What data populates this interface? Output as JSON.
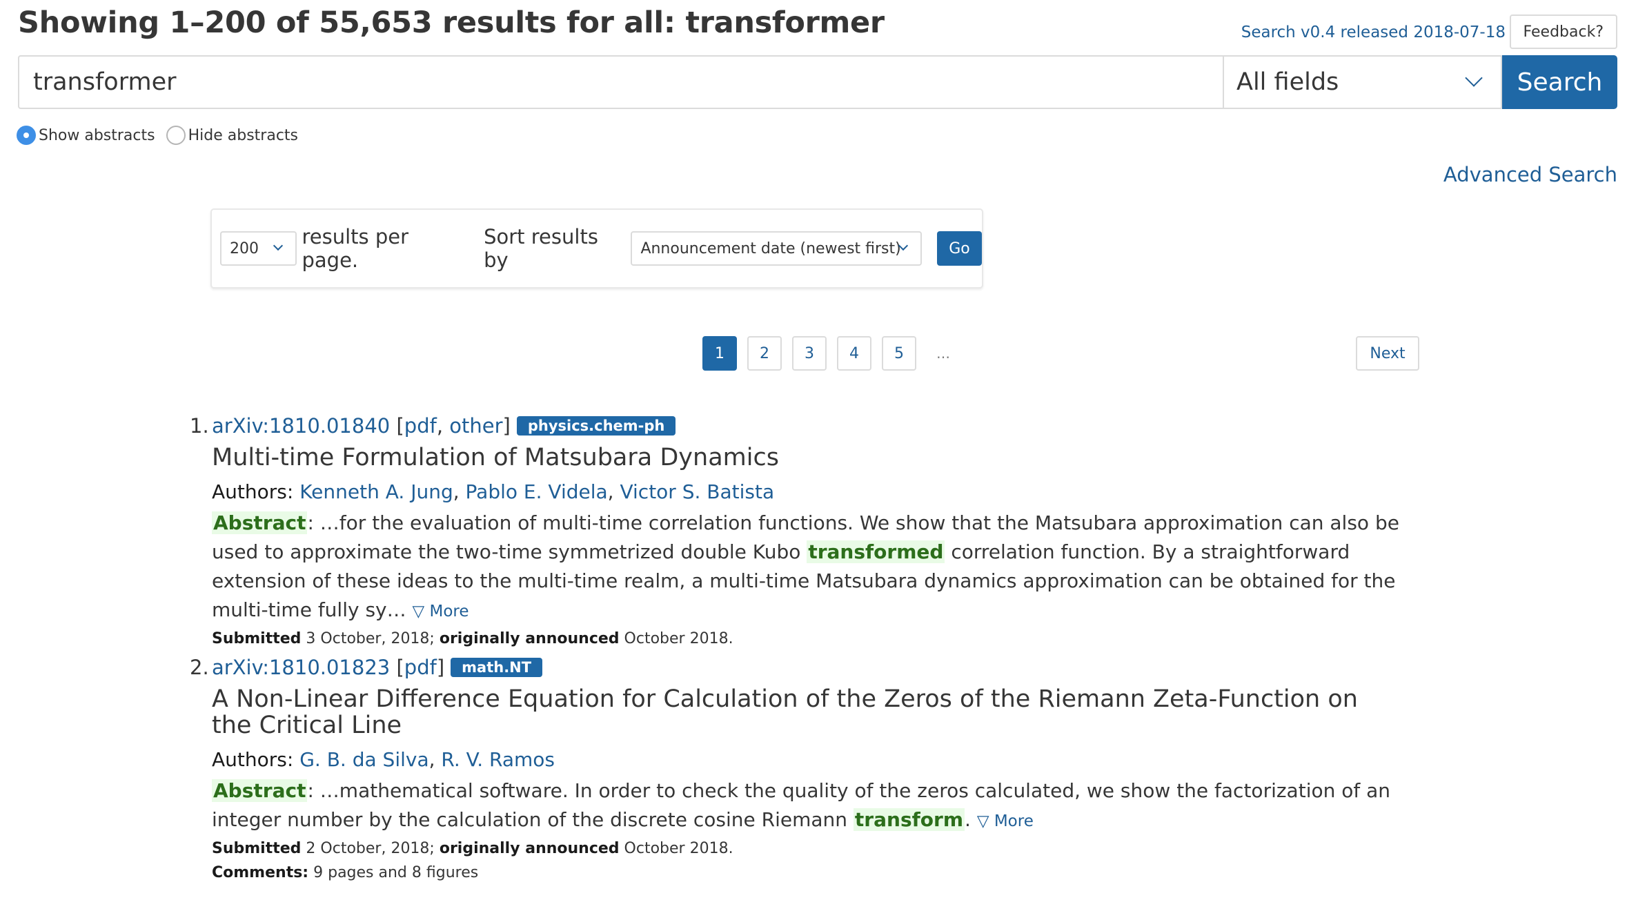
{
  "header": {
    "title": "Showing 1–200 of 55,653 results for all: transformer",
    "release_link": "Search v0.4 released 2018-07-18",
    "feedback_label": "Feedback?"
  },
  "search": {
    "query": "transformer",
    "field": "All fields",
    "button_label": "Search"
  },
  "abstract_toggle": {
    "show_label": "Show abstracts",
    "hide_label": "Hide abstracts",
    "selected": "show"
  },
  "advanced_search_label": "Advanced Search",
  "controls": {
    "per_page": "200",
    "per_page_label": "results per page.",
    "sort_label": "Sort results by",
    "sort_value": "Announcement date (newest first)",
    "go_label": "Go"
  },
  "pagination": {
    "pages": [
      "1",
      "2",
      "3",
      "4",
      "5"
    ],
    "current": "1",
    "ellipsis": "…",
    "next_label": "Next"
  },
  "colors": {
    "accent": "#1f68a6",
    "link": "#1f5e96",
    "highlight_bg": "#e9fbe6",
    "highlight_text": "#2c6e1b"
  },
  "results": [
    {
      "num": "1.",
      "arxiv_id": "arXiv:1810.01840",
      "links": [
        "pdf",
        "other"
      ],
      "category": "physics.chem-ph",
      "title": "Multi-time Formulation of Matsubara Dynamics",
      "authors_label": "Authors:",
      "authors": [
        "Kenneth A. Jung",
        "Pablo E. Videla",
        "Victor S. Batista"
      ],
      "abstract_label": "Abstract",
      "abstract_pre": ": …for the evaluation of multi-time correlation functions. We show that the Matsubara approximation can also be used to approximate the two-time symmetrized double Kubo ",
      "abstract_hl": "transformed",
      "abstract_post": " correlation function. By a straightforward extension of these ideas to the multi-time realm, a multi-time Matsubara dynamics approximation can be obtained for the multi-time fully sy… ",
      "more_label": "▽ More",
      "submitted_label": "Submitted",
      "submitted": "3 October, 2018;",
      "announced_label": "originally announced",
      "announced": "October 2018."
    },
    {
      "num": "2.",
      "arxiv_id": "arXiv:1810.01823",
      "links": [
        "pdf"
      ],
      "category": "math.NT",
      "title": "A Non-Linear Difference Equation for Calculation of the Zeros of the Riemann Zeta-Function on the Critical Line",
      "authors_label": "Authors:",
      "authors": [
        "G. B. da Silva",
        "R. V. Ramos"
      ],
      "abstract_label": "Abstract",
      "abstract_pre": ": …mathematical software. In order to check the quality of the zeros calculated, we show the factorization of an integer number by the calculation of the discrete cosine Riemann ",
      "abstract_hl": "transform",
      "abstract_post": ". ",
      "more_label": "▽ More",
      "submitted_label": "Submitted",
      "submitted": "2 October, 2018;",
      "announced_label": "originally announced",
      "announced": "October 2018.",
      "comments_label": "Comments:",
      "comments": "9 pages and 8 figures"
    }
  ]
}
